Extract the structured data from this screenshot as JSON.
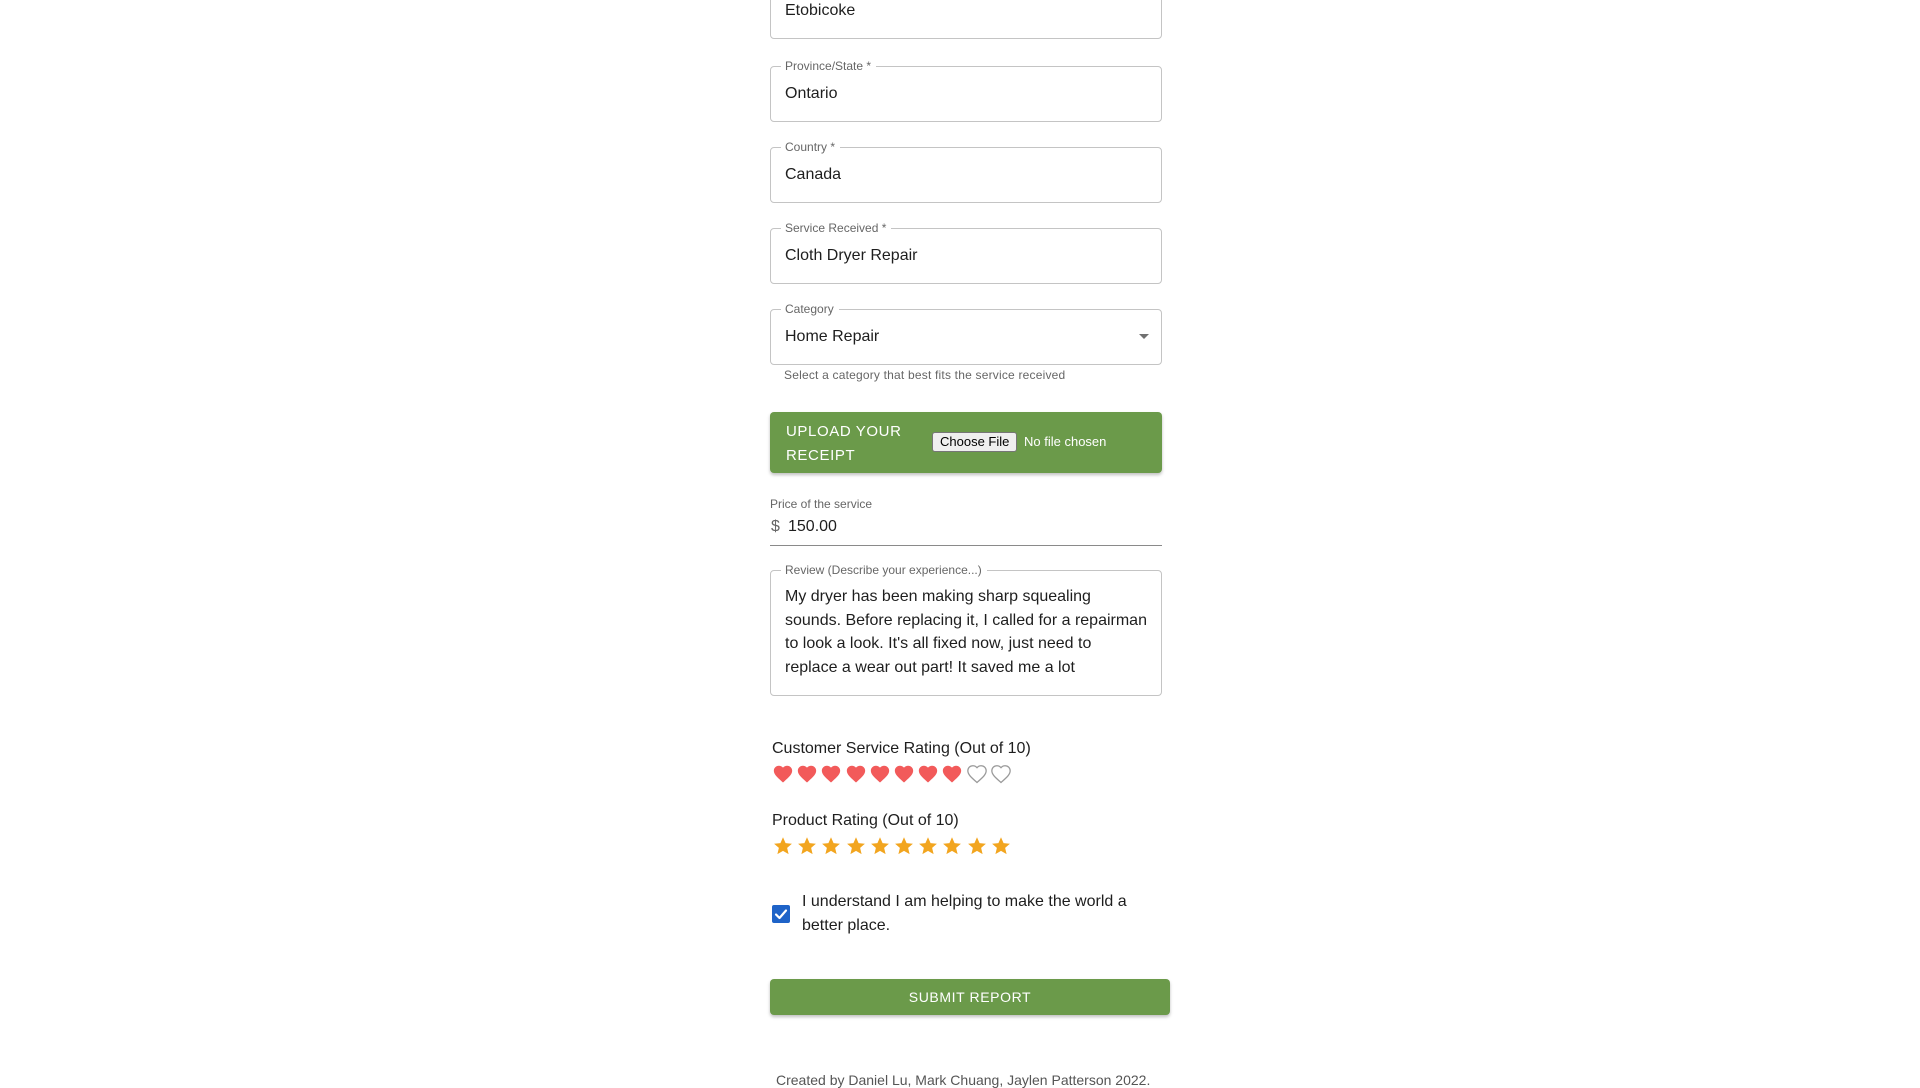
{
  "form": {
    "city": {
      "value": "Etobicoke"
    },
    "province": {
      "label": "Province/State *",
      "value": "Ontario"
    },
    "country": {
      "label": "Country *",
      "value": "Canada"
    },
    "service": {
      "label": "Service Received *",
      "value": "Cloth Dryer Repair"
    },
    "category": {
      "label": "Category",
      "value": "Home Repair",
      "helper": "Select a category that best fits the service received"
    },
    "upload": {
      "label": "UPLOAD YOUR RECEIPT",
      "button": "Choose File",
      "status": "No file chosen"
    },
    "price": {
      "label": "Price of the service",
      "currency": "$",
      "value": "150.00"
    },
    "review": {
      "label": "Review (Describe your experience...)",
      "value": "My dryer has been making sharp squealing sounds. Before replacing it, I called for a repairman to look a look. It's all fixed now, just need to replace a wear out part! It saved me a lot"
    },
    "customer_service_rating": {
      "title": "Customer Service Rating (Out of 10)",
      "value": 8,
      "max": 10,
      "icon": "heart-icon",
      "color": "#f25a5a"
    },
    "product_rating": {
      "title": "Product Rating (Out of 10)",
      "value": 10,
      "max": 10,
      "icon": "star-icon",
      "color": "#f2a51f"
    },
    "agreement": {
      "checked": true,
      "text": "I understand I am helping to make the world a better place."
    },
    "submit_label": "SUBMIT REPORT"
  },
  "footer": {
    "credits": "Created by Daniel Lu, Mark Chuang, Jaylen Patterson 2022."
  },
  "colors": {
    "accent_green": "#6b9a4a",
    "checkbox_blue": "#1e63c8"
  }
}
